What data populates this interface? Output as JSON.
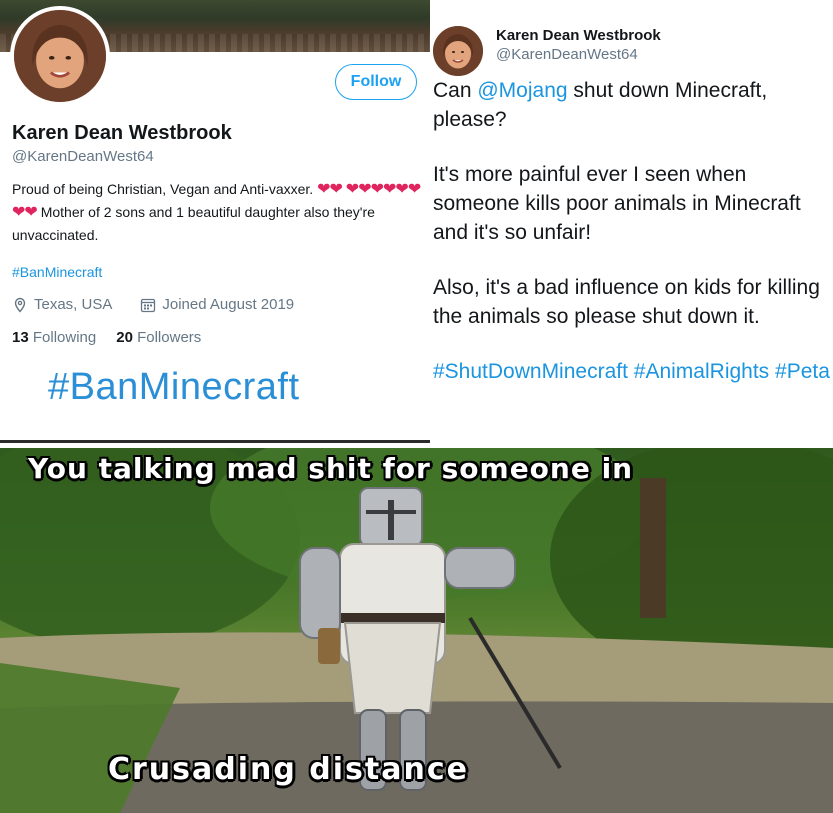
{
  "profile": {
    "name": "Karen Dean Westbrook",
    "handle": "@KarenDeanWest64",
    "follow_label": "Follow",
    "bio_line1": "Proud of being Christian, Vegan and Anti-vaxxer.",
    "bio_hearts_a": "❤❤",
    "bio_hearts_b": "❤❤❤❤❤❤❤❤",
    "bio_line2": "Mother of 2 sons and 1 beautiful daughter also they're unvaccinated.",
    "hashtag": "#BanMinecraft",
    "location": "Texas, USA",
    "joined": "Joined August 2019",
    "following_count": "13",
    "following_label": "Following",
    "followers_count": "20",
    "followers_label": "Followers",
    "big_hashtag": "#BanMinecraft"
  },
  "tweet": {
    "name": "Karen Dean Westbrook",
    "handle": "@KarenDeanWest64",
    "p1_a": "Can ",
    "p1_mention": "@Mojang",
    "p1_b": " shut down Minecraft, please?",
    "p2": "It's more painful ever I seen when someone kills poor animals in Minecraft and it's so unfair!",
    "p3": "Also, it's a bad influence on kids for killing the animals so please shut down it.",
    "tag1": "#ShutDownMinecraft",
    "tag2": "#AnimalRights",
    "tag3": "#Peta"
  },
  "meme": {
    "caption_top": "You talking mad shit for someone in",
    "caption_bottom": "Crusading distance"
  },
  "icons": {
    "location": "location-pin-icon",
    "calendar": "calendar-icon"
  },
  "colors": {
    "link": "#1b95e0",
    "follow": "#1da1f2",
    "heart": "#e0245e"
  }
}
